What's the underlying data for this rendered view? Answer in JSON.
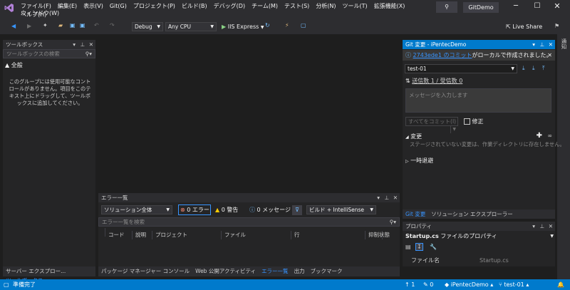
{
  "menu": {
    "items": [
      "ファイル(F)",
      "編集(E)",
      "表示(V)",
      "Git(G)",
      "プロジェクト(P)",
      "ビルド(B)",
      "デバッグ(D)",
      "チーム(M)",
      "テスト(S)",
      "分析(N)",
      "ツール(T)",
      "拡張機能(X)",
      "ウィンドウ(W)"
    ],
    "help": "ヘルプ(H)",
    "search_icon": "search-icon",
    "solution_name": "GitDemo"
  },
  "toolbar": {
    "config": "Debug",
    "platform": "Any CPU",
    "run_label": "IIS Express",
    "live_share": "Live Share"
  },
  "toolbox": {
    "title": "ツールボックス",
    "search_placeholder": "ツールボックスの検索",
    "group": "▲ 全般",
    "empty_text": "このグループには使用可能なコントロールがありません。項目をこのテキスト上にドラッグして、ツールボックスに追加してください。"
  },
  "left_tabs": [
    "サーバー エクスプロー...",
    "ツールボックス"
  ],
  "error_list": {
    "title": "エラー一覧",
    "scope": "ソリューション全体",
    "errors": "0 エラー",
    "warnings": "0 警告",
    "messages": "0 メッセージ",
    "build_filter": "ビルド + IntelliSense",
    "search_placeholder": "エラー一覧を検索",
    "columns": [
      "コード",
      "説明",
      "プロジェクト",
      "ファイル",
      "行",
      "抑制状態"
    ]
  },
  "bottom_tabs": [
    "パッケージ マネージャー コンソール",
    "Web 公開アクティビティ",
    "エラー一覧",
    "出力",
    "ブックマーク"
  ],
  "git": {
    "title": "Git 変更 - iPentecDemo",
    "info_link": "2743ede1 のコミット",
    "info_text": "がローカルで作成されました。",
    "branch": "test-01",
    "sync": "送信数 1 / 受信数 0",
    "message_placeholder": "メッセージを入力します",
    "commit_all": "すべてをコミット(I)",
    "amend": "修正",
    "changes_header": "変更",
    "changes_text": "ステージされていない変更は、作業ディレクトリに存在しません。",
    "stash": "一時退避"
  },
  "right_tabs": [
    "Git 変更",
    "ソリューション エクスプローラー"
  ],
  "properties": {
    "title": "プロパティ",
    "object": "Startup.cs",
    "object_suffix": "ファイルのプロパティ",
    "row_name": "ファイル名",
    "row_value": "Startup.cs"
  },
  "side_label": "通知",
  "status": {
    "ready": "準備完了",
    "up": "1",
    "pencil": "0",
    "repo": "iPentecDemo",
    "branch": "test-01"
  },
  "colors": {
    "accent": "#007acc",
    "link": "#3794ff",
    "bg": "#1e1e1e",
    "panel": "#252526"
  }
}
